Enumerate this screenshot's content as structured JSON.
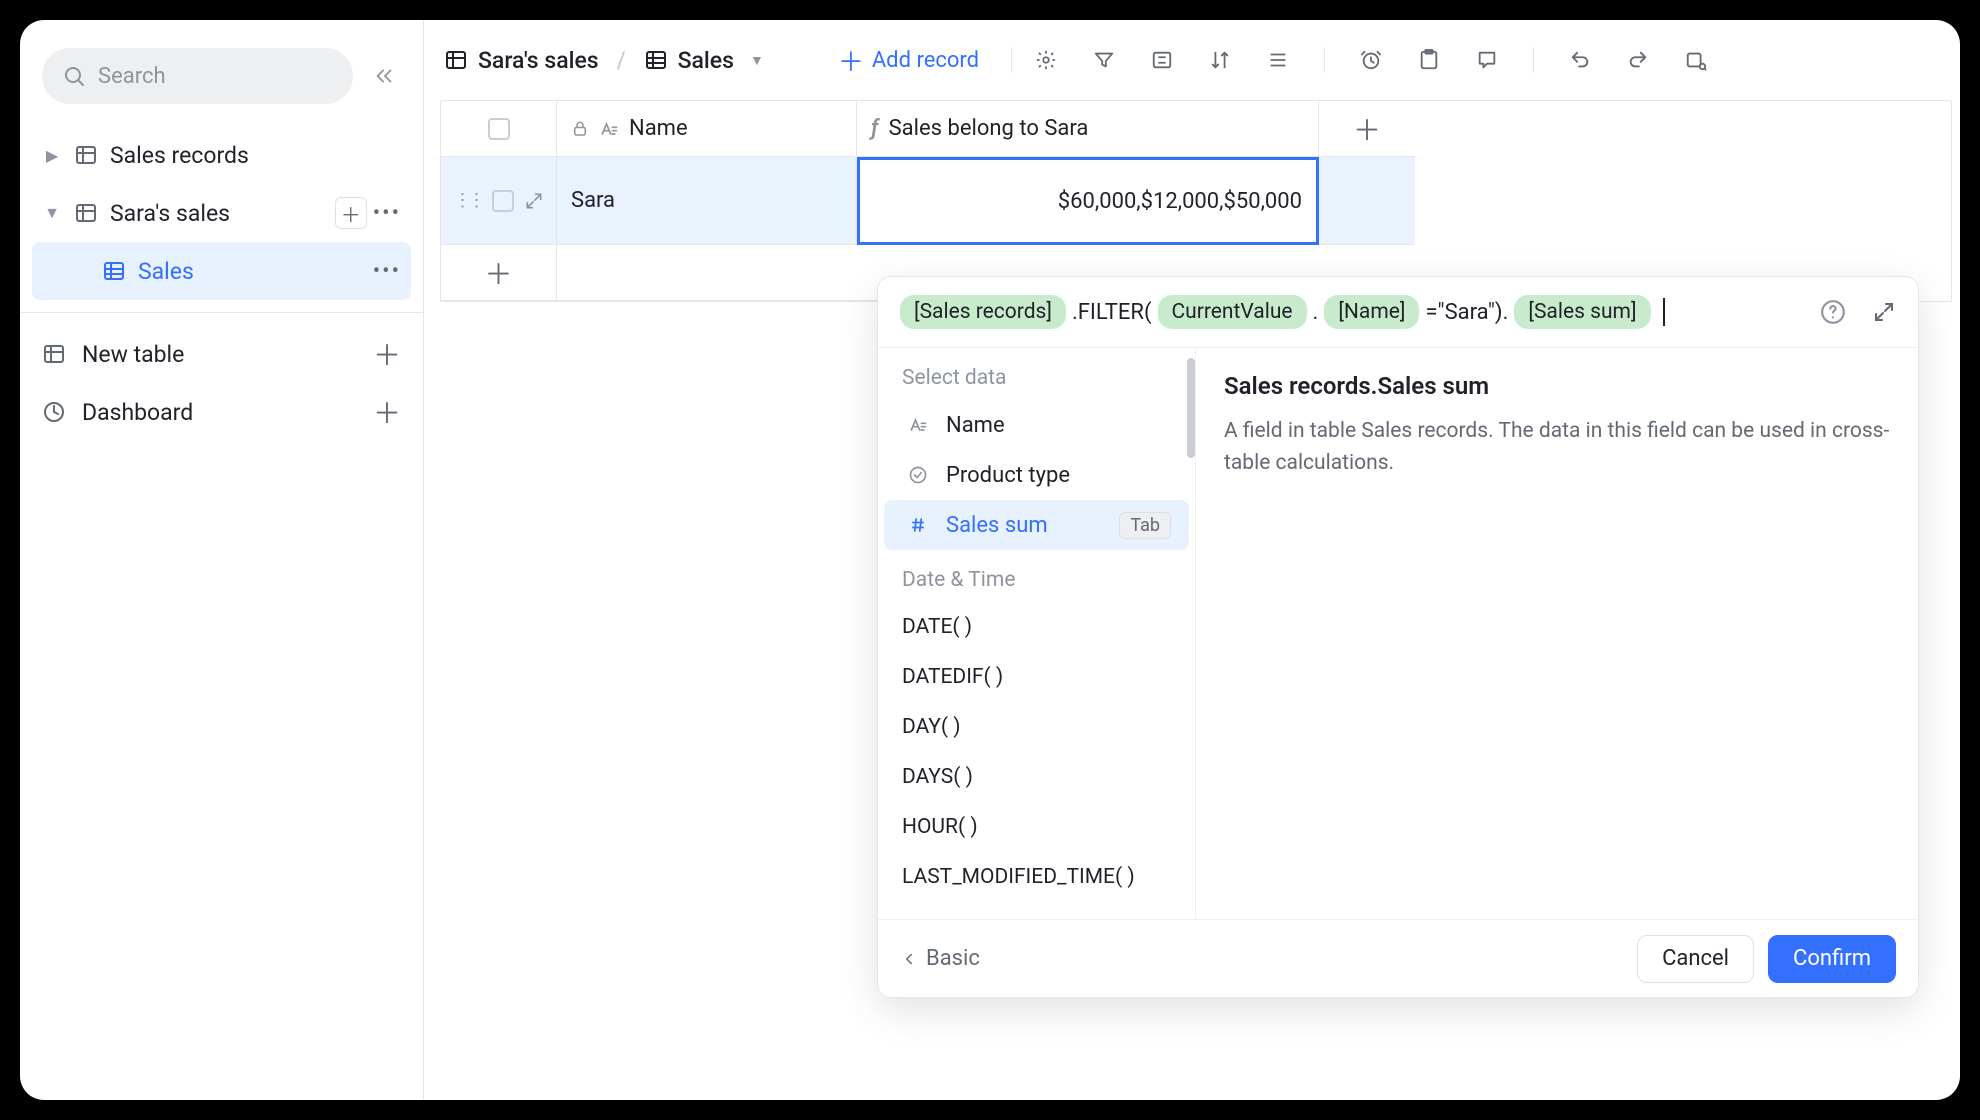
{
  "sidebar": {
    "search_placeholder": "Search",
    "items": [
      {
        "label": "Sales records",
        "expanded": false
      },
      {
        "label": "Sara's sales",
        "expanded": true,
        "children": [
          {
            "label": "Sales",
            "active": true
          }
        ]
      }
    ],
    "nav": [
      {
        "label": "New table"
      },
      {
        "label": "Dashboard"
      }
    ]
  },
  "toolbar": {
    "breadcrumb_1": "Sara's sales",
    "breadcrumb_2": "Sales",
    "add_record_label": "Add record"
  },
  "table": {
    "columns": [
      {
        "label": "Name",
        "type": "text"
      },
      {
        "label": "Sales belong to Sara",
        "type": "formula"
      }
    ],
    "rows": [
      {
        "name": "Sara",
        "formula_value": "$60,000,$12,000,$50,000"
      }
    ]
  },
  "formula_editor": {
    "expression": {
      "chip1": "[Sales records]",
      "text1": ".FILTER(",
      "chip2": "CurrentValue",
      "text2": ".",
      "chip3": "[Name]",
      "text3": "=\"Sara\").",
      "chip4": "[Sales sum]"
    },
    "suggestions": {
      "section1_label": "Select data",
      "items": [
        {
          "label": "Name",
          "icon": "text"
        },
        {
          "label": "Product type",
          "icon": "select"
        },
        {
          "label": "Sales sum",
          "icon": "number",
          "active": true,
          "hint": "Tab"
        }
      ],
      "section2_label": "Date & Time",
      "functions": [
        "DATE( )",
        "DATEDIF( )",
        "DAY( )",
        "DAYS( )",
        "HOUR( )",
        "LAST_MODIFIED_TIME( )"
      ]
    },
    "doc": {
      "title": "Sales records.Sales sum",
      "body": "A field in table Sales records. The data in this field can be used in cross-table calculations."
    },
    "footer": {
      "basic_label": "Basic",
      "cancel_label": "Cancel",
      "confirm_label": "Confirm"
    }
  }
}
